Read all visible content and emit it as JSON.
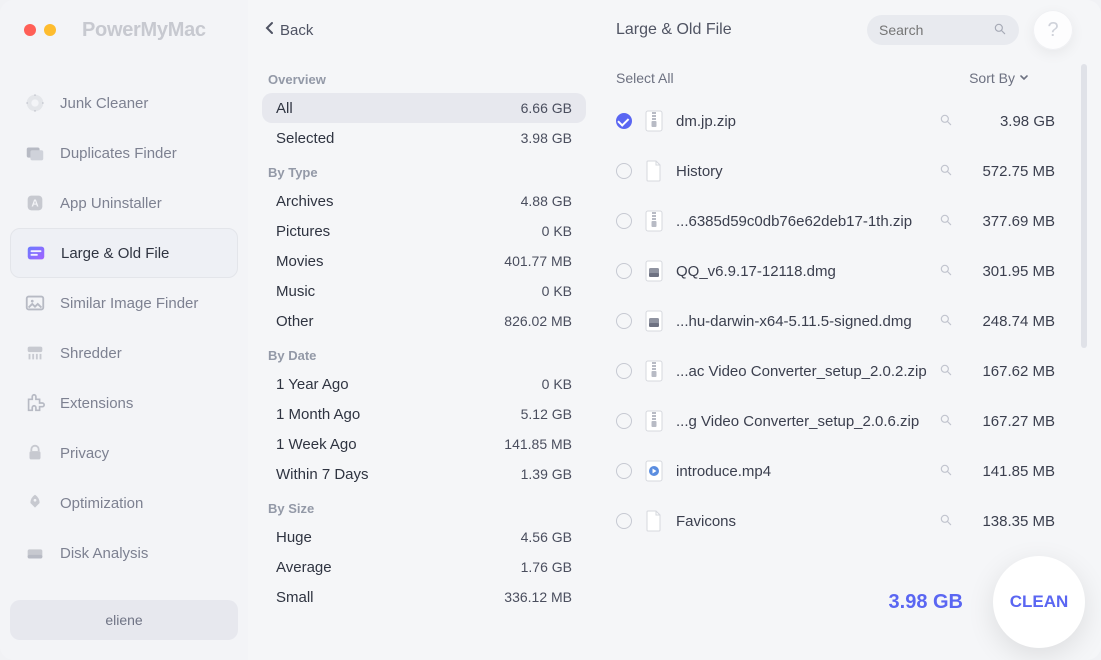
{
  "app": {
    "title": "PowerMyMac"
  },
  "back": "Back",
  "sidebar": {
    "items": [
      {
        "label": "Junk Cleaner"
      },
      {
        "label": "Duplicates Finder"
      },
      {
        "label": "App Uninstaller"
      },
      {
        "label": "Large & Old File"
      },
      {
        "label": "Similar Image Finder"
      },
      {
        "label": "Shredder"
      },
      {
        "label": "Extensions"
      },
      {
        "label": "Privacy"
      },
      {
        "label": "Optimization"
      },
      {
        "label": "Disk Analysis"
      }
    ],
    "user": "eliene"
  },
  "categories": {
    "overview_label": "Overview",
    "overview": [
      {
        "label": "All",
        "value": "6.66 GB"
      },
      {
        "label": "Selected",
        "value": "3.98 GB"
      }
    ],
    "bytype_label": "By Type",
    "bytype": [
      {
        "label": "Archives",
        "value": "4.88 GB"
      },
      {
        "label": "Pictures",
        "value": "0 KB"
      },
      {
        "label": "Movies",
        "value": "401.77 MB"
      },
      {
        "label": "Music",
        "value": "0 KB"
      },
      {
        "label": "Other",
        "value": "826.02 MB"
      }
    ],
    "bydate_label": "By Date",
    "bydate": [
      {
        "label": "1 Year Ago",
        "value": "0 KB"
      },
      {
        "label": "1 Month Ago",
        "value": "5.12 GB"
      },
      {
        "label": "1 Week Ago",
        "value": "141.85 MB"
      },
      {
        "label": "Within 7 Days",
        "value": "1.39 GB"
      }
    ],
    "bysize_label": "By Size",
    "bysize": [
      {
        "label": "Huge",
        "value": "4.56 GB"
      },
      {
        "label": "Average",
        "value": "1.76 GB"
      },
      {
        "label": "Small",
        "value": "336.12 MB"
      }
    ]
  },
  "page": {
    "title": "Large & Old File",
    "search_placeholder": "Search",
    "help": "?",
    "select_all": "Select All",
    "sort_by": "Sort By",
    "total": "3.98 GB",
    "clean": "CLEAN"
  },
  "files": [
    {
      "name": "dm.jp.zip",
      "size": "3.98 GB",
      "checked": true,
      "icon": "zip"
    },
    {
      "name": "History",
      "size": "572.75 MB",
      "checked": false,
      "icon": "file"
    },
    {
      "name": "...6385d59c0db76e62deb17-1th.zip",
      "size": "377.69 MB",
      "checked": false,
      "icon": "zip"
    },
    {
      "name": "QQ_v6.9.17-12118.dmg",
      "size": "301.95 MB",
      "checked": false,
      "icon": "dmg"
    },
    {
      "name": "...hu-darwin-x64-5.11.5-signed.dmg",
      "size": "248.74 MB",
      "checked": false,
      "icon": "dmg"
    },
    {
      "name": "...ac Video Converter_setup_2.0.2.zip",
      "size": "167.62 MB",
      "checked": false,
      "icon": "zip"
    },
    {
      "name": "...g Video Converter_setup_2.0.6.zip",
      "size": "167.27 MB",
      "checked": false,
      "icon": "zip"
    },
    {
      "name": "introduce.mp4",
      "size": "141.85 MB",
      "checked": false,
      "icon": "mp4"
    },
    {
      "name": "Favicons",
      "size": "138.35 MB",
      "checked": false,
      "icon": "file"
    }
  ]
}
